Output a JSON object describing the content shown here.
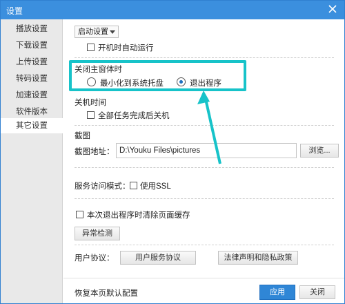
{
  "window": {
    "title": "设置"
  },
  "sidebar": {
    "items": [
      {
        "label": "播放设置",
        "active": false
      },
      {
        "label": "下载设置",
        "active": false
      },
      {
        "label": "上传设置",
        "active": false
      },
      {
        "label": "转码设置",
        "active": false
      },
      {
        "label": "加速设置",
        "active": false
      },
      {
        "label": "软件版本",
        "active": false
      },
      {
        "label": "其它设置",
        "active": true
      }
    ]
  },
  "startup": {
    "select_value": "启动设置",
    "autorun_label": "开机时自动运行",
    "autorun_checked": false
  },
  "close_window": {
    "heading": "关闭主窗体时",
    "option_minimize": "最小化到系统托盘",
    "option_exit": "退出程序",
    "selected": "exit"
  },
  "shutdown": {
    "heading": "关机时间",
    "label": "全部任务完成后关机",
    "checked": false
  },
  "screenshot": {
    "heading": "截图",
    "path_label": "截图地址：",
    "path_value": "D:\\Youku Files\\pictures",
    "browse_label": "浏览..."
  },
  "service": {
    "mode_label": "服务访问模式：",
    "ssl_label": "使用SSL",
    "ssl_checked": false
  },
  "cache": {
    "clear_label": "本次退出程序时清除页面缓存",
    "clear_checked": false,
    "detect_label": "异常检测"
  },
  "agreement": {
    "label": "用户协议：",
    "service_agreement": "用户服务协议",
    "legal_privacy": "法律声明和隐私政策"
  },
  "footer": {
    "reset_label": "恢复本页默认配置",
    "apply_label": "应用",
    "close_label": "关闭"
  },
  "colors": {
    "titlebar": "#3b8fde",
    "highlight": "#17c3c9",
    "primary_button": "#2f86d6"
  }
}
